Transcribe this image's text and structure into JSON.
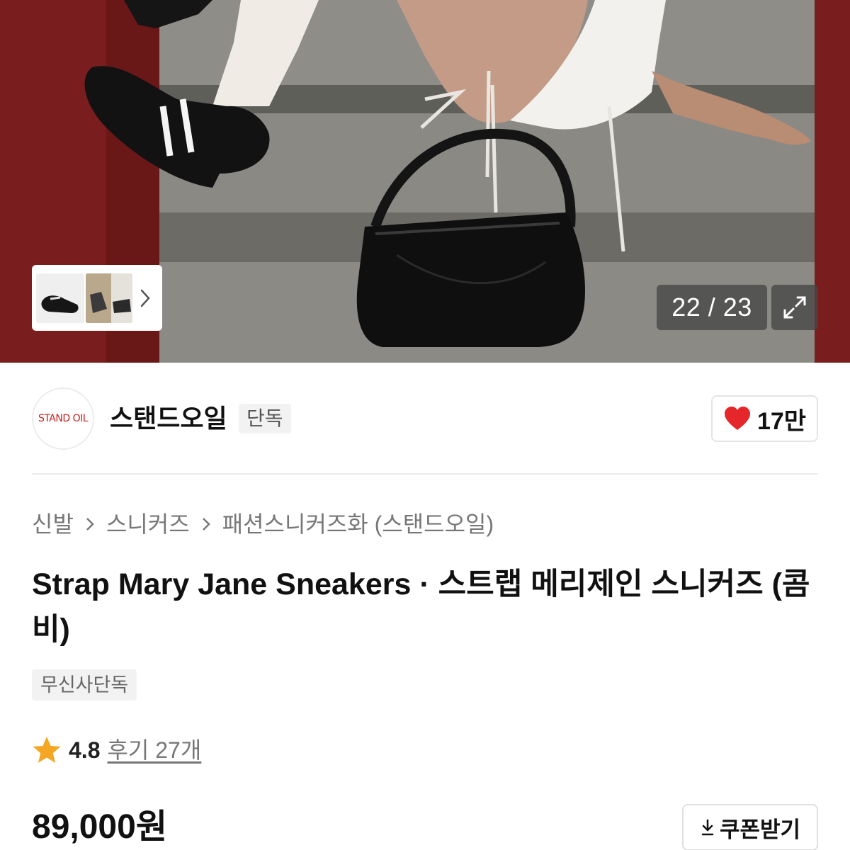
{
  "gallery": {
    "counter_current": "22",
    "counter_separator": "/",
    "counter_total": "23",
    "counter_text": "22 / 23"
  },
  "brand": {
    "logo_text": "STAND OIL",
    "name": "스탠드오일",
    "tag": "단독",
    "likes": "17만",
    "accent_color": "#c8201e",
    "heart_color": "#e5262a"
  },
  "breadcrumb": [
    "신발",
    "스니커즈",
    "패션스니커즈화 (스탠드오일)"
  ],
  "product": {
    "title": "Strap Mary Jane Sneakers · 스트랩 메리제인 스니커즈 (콤비)",
    "exclusive_badge": "무신사단독",
    "rating": "4.8",
    "reviews": "후기 27개",
    "price": "89,000원",
    "coupon_label": "쿠폰받기",
    "star_color": "#f5a623"
  }
}
